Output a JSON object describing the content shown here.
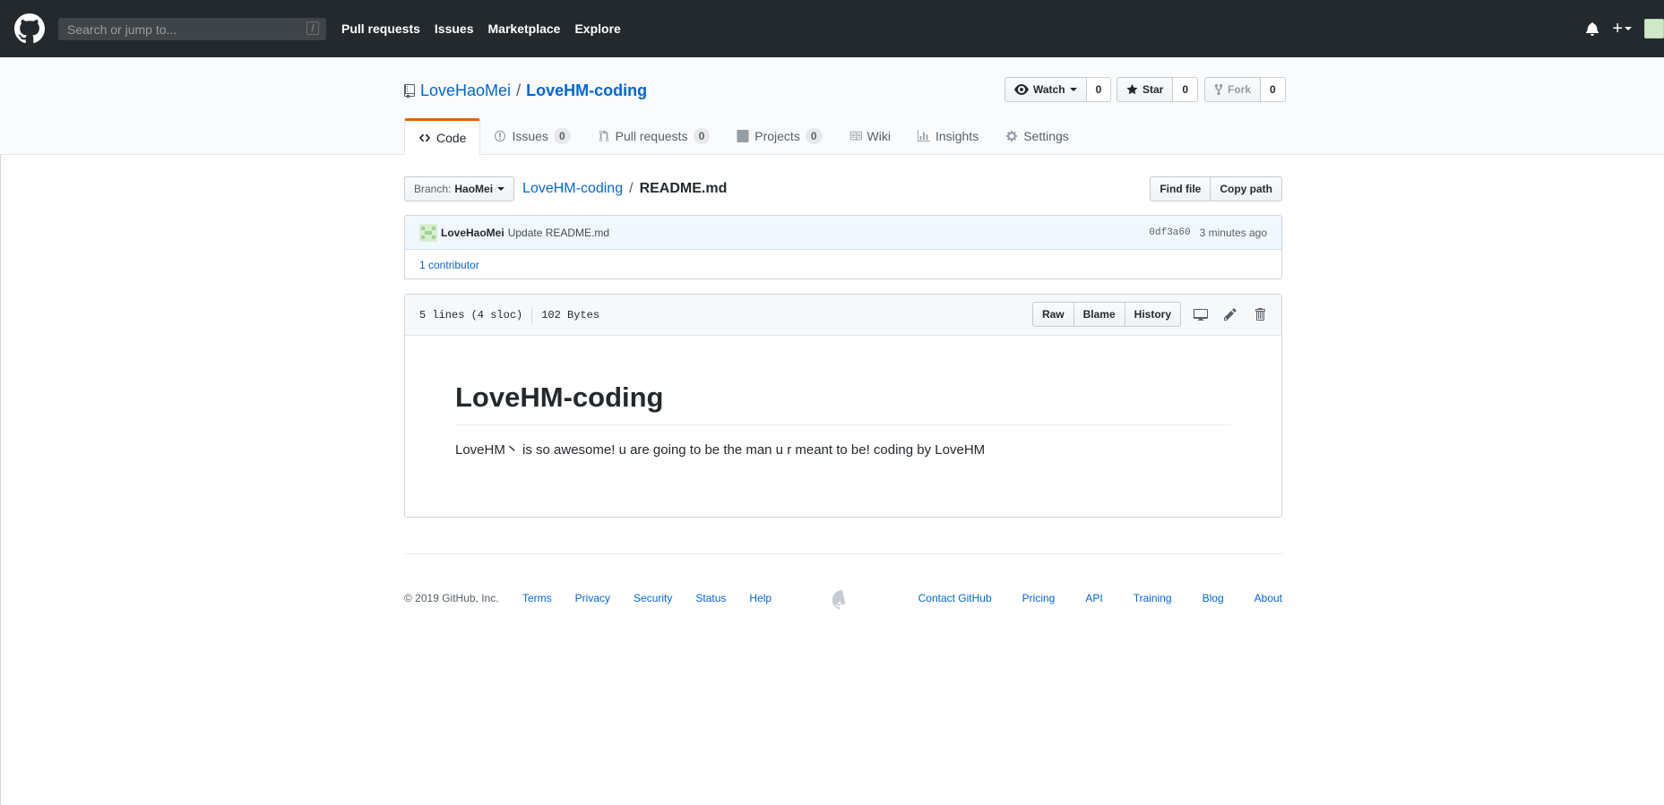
{
  "header": {
    "search_placeholder": "Search or jump to...",
    "search_key": "/",
    "nav": [
      "Pull requests",
      "Issues",
      "Marketplace",
      "Explore"
    ],
    "plus_label": "+"
  },
  "repo": {
    "owner": "LoveHaoMei",
    "separator": "/",
    "name": "LoveHM-coding",
    "watch_label": "Watch",
    "watch_count": "0",
    "star_label": "Star",
    "star_count": "0",
    "fork_label": "Fork",
    "fork_count": "0"
  },
  "tabs": [
    {
      "label": "Code",
      "count": ""
    },
    {
      "label": "Issues",
      "count": "0"
    },
    {
      "label": "Pull requests",
      "count": "0"
    },
    {
      "label": "Projects",
      "count": "0"
    },
    {
      "label": "Wiki",
      "count": ""
    },
    {
      "label": "Insights",
      "count": ""
    },
    {
      "label": "Settings",
      "count": ""
    }
  ],
  "file_nav": {
    "branch_prefix": "Branch:",
    "branch": "HaoMei",
    "path_repo": "LoveHM-coding",
    "path_sep": "/",
    "path_file": "README.md",
    "find_file": "Find file",
    "copy_path": "Copy path"
  },
  "commit": {
    "author": "LoveHaoMei",
    "message": "Update README.md",
    "sha": "0df3a60",
    "time": "3 minutes ago",
    "contributors": "1 contributor"
  },
  "file": {
    "lines": "5 lines (4 sloc)",
    "size": "102 Bytes",
    "raw": "Raw",
    "blame": "Blame",
    "history": "History"
  },
  "readme": {
    "heading": "LoveHM-coding",
    "body": "LoveHM丶 is so awesome! u are going to be the man u r meant to be! coding by LoveHM"
  },
  "footer": {
    "copyright": "© 2019 GitHub, Inc.",
    "left_links": [
      "Terms",
      "Privacy",
      "Security",
      "Status",
      "Help"
    ],
    "right_links": [
      "Contact GitHub",
      "Pricing",
      "API",
      "Training",
      "Blog",
      "About"
    ]
  },
  "colors": {
    "header_bg": "#24292e",
    "link": "#0366d6",
    "tab_accent": "#e36209"
  }
}
